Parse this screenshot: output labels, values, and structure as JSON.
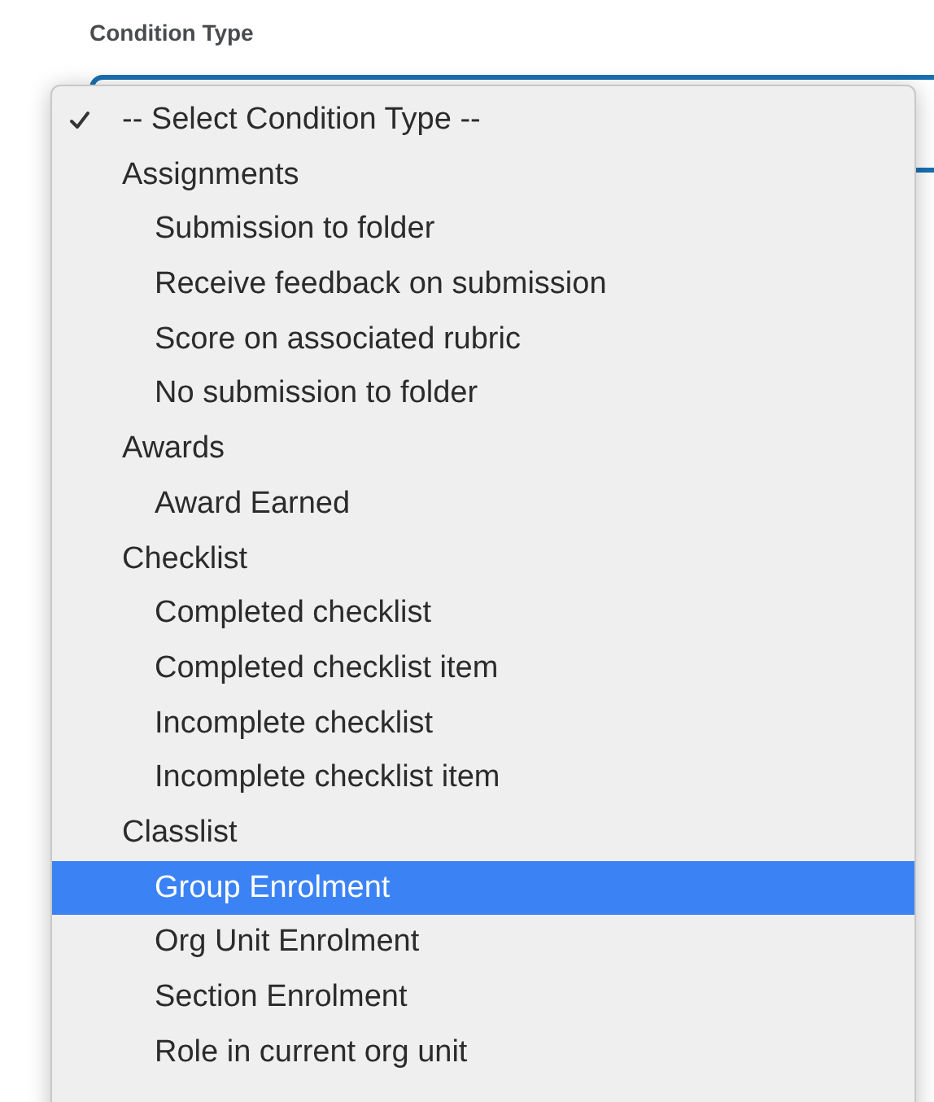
{
  "label": "Condition Type",
  "menu": {
    "placeholder": {
      "label": "-- Select Condition Type --",
      "checked": true,
      "selected": false
    },
    "groups": [
      {
        "label": "Assignments",
        "items": [
          {
            "label": "Submission to folder",
            "selected": false
          },
          {
            "label": "Receive feedback on submission",
            "selected": false
          },
          {
            "label": "Score on associated rubric",
            "selected": false
          },
          {
            "label": "No submission to folder",
            "selected": false
          }
        ]
      },
      {
        "label": "Awards",
        "items": [
          {
            "label": "Award Earned",
            "selected": false
          }
        ]
      },
      {
        "label": "Checklist",
        "items": [
          {
            "label": "Completed checklist",
            "selected": false
          },
          {
            "label": "Completed checklist item",
            "selected": false
          },
          {
            "label": "Incomplete checklist",
            "selected": false
          },
          {
            "label": "Incomplete checklist item",
            "selected": false
          }
        ]
      },
      {
        "label": "Classlist",
        "items": [
          {
            "label": "Group Enrolment",
            "selected": true
          },
          {
            "label": "Org Unit Enrolment",
            "selected": false
          },
          {
            "label": "Section Enrolment",
            "selected": false
          },
          {
            "label": "Role in current org unit",
            "selected": false
          }
        ]
      }
    ]
  }
}
